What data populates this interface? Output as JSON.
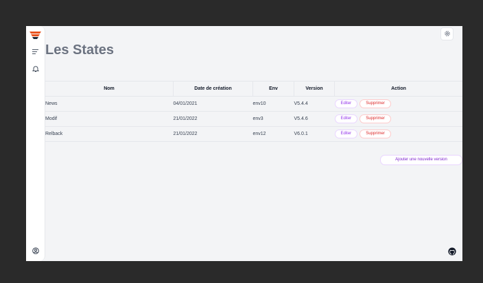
{
  "page": {
    "title": "Les States"
  },
  "table": {
    "headers": [
      "Nom",
      "Date de création",
      "Env",
      "Version",
      "Action"
    ],
    "rows": [
      {
        "nom": "News",
        "date": "04/01/2021",
        "env": "env10",
        "version": "V5.4.4"
      },
      {
        "nom": "Modif",
        "date": "21/01/2022",
        "env": "env3",
        "version": "V5.4.6"
      },
      {
        "nom": "Relback",
        "date": "21/01/2022",
        "env": "env12",
        "version": "V6.0.1"
      }
    ],
    "edit_label": "Editer",
    "delete_label": "Supprimer"
  },
  "add_button": "Ajouter une nouvelle version",
  "icons": {
    "logo": "app-logo-icon",
    "menu": "menu-icon",
    "bell": "bell-icon",
    "user": "user-circle-icon",
    "settings": "gear-icon",
    "github": "github-icon"
  },
  "colors": {
    "brand": "#e8531f",
    "accent_purple": "#9333ea",
    "danger": "#dc2626",
    "title_gray": "#6b7280"
  }
}
